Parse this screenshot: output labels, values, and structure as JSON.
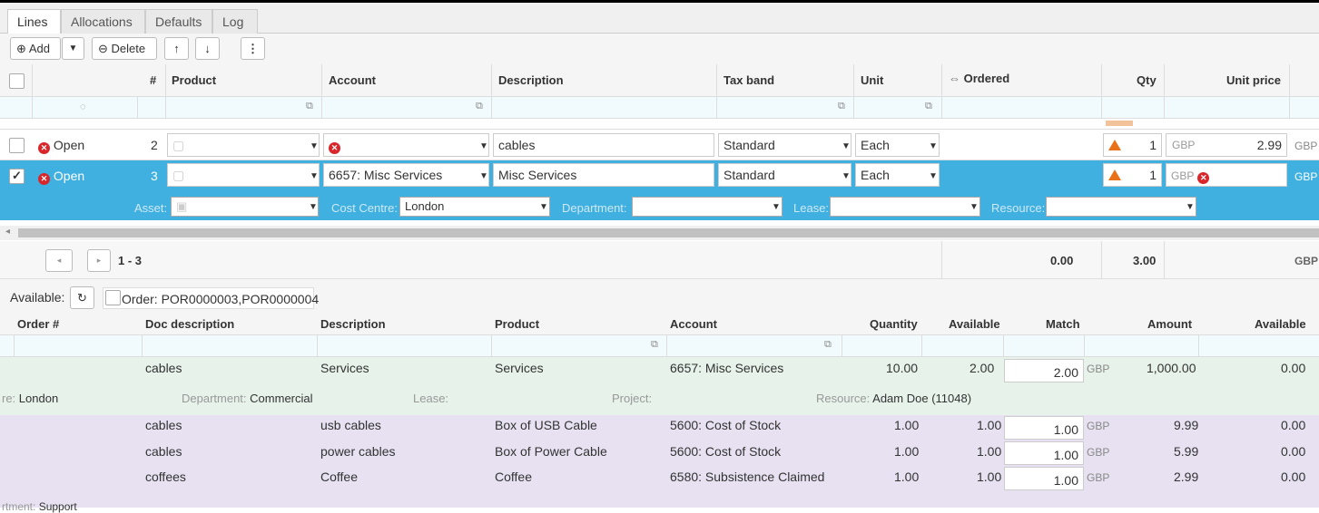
{
  "tabs": [
    "Lines",
    "Allocations",
    "Defaults",
    "Log"
  ],
  "toolbar": {
    "add": "Add",
    "delete": "Delete"
  },
  "columns": {
    "num": "#",
    "product": "Product",
    "account": "Account",
    "description": "Description",
    "tax_band": "Tax band",
    "unit": "Unit",
    "ordered": "Ordered",
    "qty": "Qty",
    "unit_price": "Unit price"
  },
  "rows": [
    {
      "status": "Open",
      "num": "2",
      "account": "",
      "description": "cables",
      "tax_band": "Standard",
      "unit": "Each",
      "qty": "1",
      "currency": "GBP",
      "price": "2.99",
      "ccy2": "GBP"
    },
    {
      "status": "Open",
      "num": "3",
      "account": "6657: Misc Services",
      "description": "Misc Services",
      "tax_band": "Standard",
      "unit": "Each",
      "qty": "1",
      "currency": "GBP",
      "price": "",
      "ccy2": "GBP"
    }
  ],
  "selected_details": {
    "asset_label": "Asset:",
    "cost_centre_label": "Cost Centre:",
    "cost_centre": "London",
    "department_label": "Department:",
    "lease_label": "Lease:",
    "resource_label": "Resource:"
  },
  "footer": {
    "range": "1 - 3",
    "ordered_total": "0.00",
    "qty_total": "3.00",
    "currency": "GBP"
  },
  "available": {
    "label": "Available:",
    "order_label": "Order: POR0000003,POR0000004"
  },
  "columns2": {
    "order": "Order #",
    "doc_desc": "Doc description",
    "description": "Description",
    "product": "Product",
    "account": "Account",
    "quantity": "Quantity",
    "available": "Available",
    "match": "Match",
    "amount": "Amount",
    "available2": "Available"
  },
  "match_rows": [
    {
      "doc": "cables",
      "desc": "Services",
      "product": "Services",
      "account": "6657: Misc Services",
      "quantity": "10.00",
      "available": "2.00",
      "match": "2.00",
      "currency": "GBP",
      "amount": "1,000.00",
      "available2": "0.00"
    },
    {
      "doc": "cables",
      "desc": "usb cables",
      "product": "Box of USB Cable",
      "account": "5600: Cost of Stock",
      "quantity": "1.00",
      "available": "1.00",
      "match": "1.00",
      "currency": "GBP",
      "amount": "9.99",
      "available2": "0.00"
    },
    {
      "doc": "cables",
      "desc": "power cables",
      "product": "Box of Power Cable",
      "account": "5600: Cost of Stock",
      "quantity": "1.00",
      "available": "1.00",
      "match": "1.00",
      "currency": "GBP",
      "amount": "5.99",
      "available2": "0.00"
    },
    {
      "doc": "coffees",
      "desc": "Coffee",
      "product": "Coffee",
      "account": "6580: Subsistence Claimed",
      "quantity": "1.00",
      "available": "1.00",
      "match": "1.00",
      "currency": "GBP",
      "amount": "2.99",
      "available2": "0.00"
    }
  ],
  "green_details": {
    "cc_label": "re:",
    "cc": "London",
    "dept_label": "Department:",
    "dept": "Commercial",
    "lease_label": "Lease:",
    "project_label": "Project:",
    "resource_label": "Resource:",
    "resource": "Adam Doe (11048)"
  },
  "bottom_text": {
    "label": "rtment:",
    "value": "Support"
  }
}
